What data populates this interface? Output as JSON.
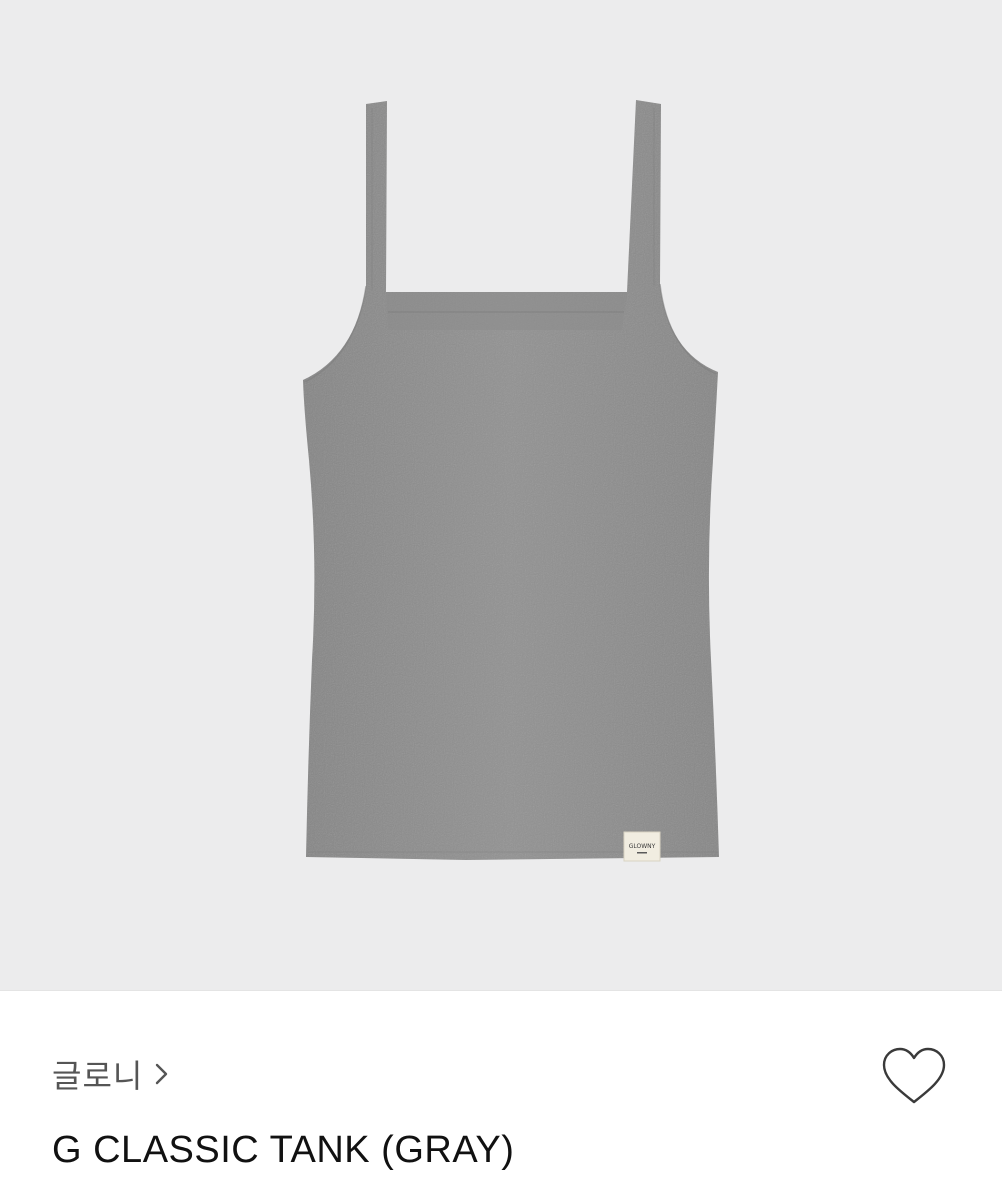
{
  "product": {
    "image_alt": "G CLASSIC TANK gray camisole tank top",
    "label_text": "GLOWNY",
    "brand": "글로니",
    "name": "G CLASSIC TANK (GRAY)",
    "wishlisted": false
  },
  "icons": {
    "brand_chevron": "chevron-right-icon",
    "wishlist": "heart-outline-icon"
  },
  "colors": {
    "image_background": "#ececed",
    "garment": "#8e8e8e",
    "text_primary": "#111111",
    "text_secondary": "#555555"
  }
}
